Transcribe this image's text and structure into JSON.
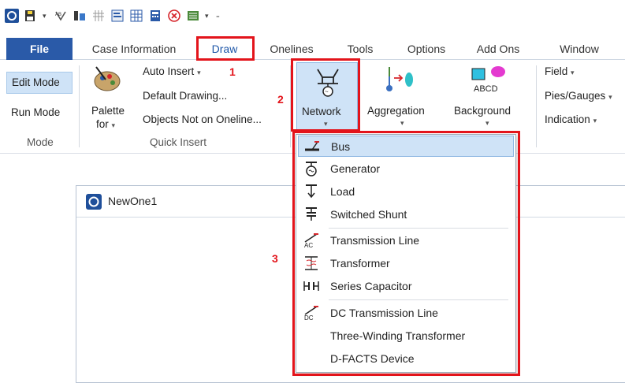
{
  "qat": {
    "icons": [
      "app-icon",
      "save-icon",
      "undo-icon",
      "network-tool-icon",
      "grid-icon",
      "form-icon",
      "table-icon",
      "close-circle-icon",
      "print-icon"
    ]
  },
  "tabs": {
    "file": "File",
    "case_information": "Case Information",
    "draw": "Draw",
    "onelines": "Onelines",
    "tools": "Tools",
    "options": "Options",
    "add_ons": "Add Ons",
    "window": "Window"
  },
  "ribbon": {
    "mode": {
      "edit_mode": "Edit Mode",
      "run_mode": "Run Mode",
      "group_label": "Mode"
    },
    "quick_insert": {
      "palette_line1": "Palette",
      "palette_line2": "for",
      "auto_insert": "Auto Insert",
      "default_drawing": "Default Drawing...",
      "objects_not_on_oneline": "Objects Not on Oneline...",
      "group_label": "Quick Insert"
    },
    "network": "Network",
    "aggregation": "Aggregation",
    "background": "Background",
    "background_icon_text": "ABCD",
    "field": "Field",
    "pies_gauges": "Pies/Gauges",
    "indication": "Indication"
  },
  "annotations": {
    "n1": "1",
    "n2": "2",
    "n3": "3"
  },
  "document": {
    "title": "NewOne1"
  },
  "menu": {
    "items": [
      {
        "label": "Bus",
        "icon": "bus-icon"
      },
      {
        "label": "Generator",
        "icon": "generator-icon"
      },
      {
        "label": "Load",
        "icon": "load-icon"
      },
      {
        "label": "Switched Shunt",
        "icon": "switched-shunt-icon"
      },
      {
        "label": "Transmission Line",
        "icon": "transmission-line-icon"
      },
      {
        "label": "Transformer",
        "icon": "transformer-icon"
      },
      {
        "label": "Series Capacitor",
        "icon": "series-capacitor-icon"
      },
      {
        "label": "DC Transmission Line",
        "icon": "dc-transmission-line-icon"
      },
      {
        "label": "Three-Winding Transformer",
        "icon": ""
      },
      {
        "label": "D-FACTS Device",
        "icon": ""
      }
    ]
  },
  "colors": {
    "file_tab": "#2a5aa8",
    "highlight": "#cfe3f7",
    "annotation_red": "#e3141b"
  }
}
